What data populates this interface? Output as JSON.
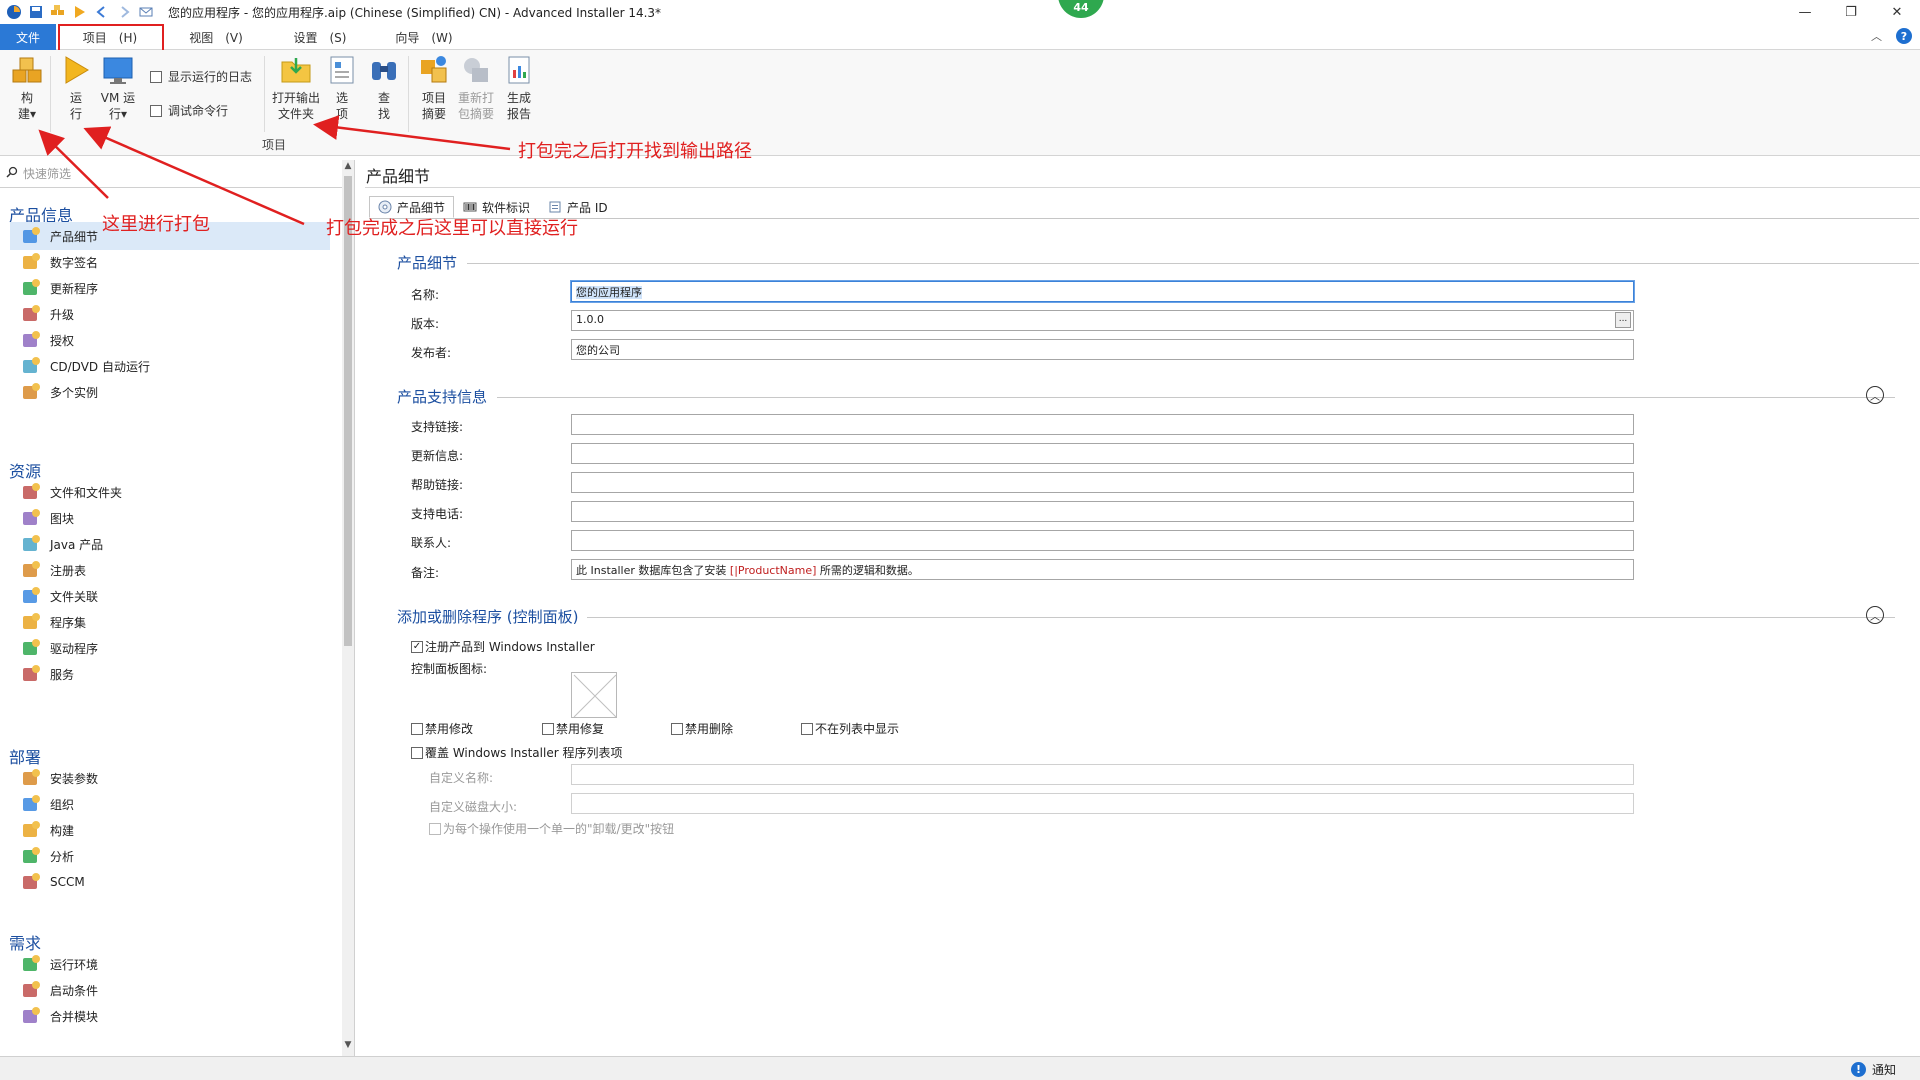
{
  "titlebar": {
    "title": "您的应用程序 - 您的应用程序.aip (Chinese (Simplified) CN) - Advanced Installer 14.3*",
    "badge": "44",
    "controls": {
      "minimize": "—",
      "restore": "❐",
      "close": "✕"
    }
  },
  "menu": {
    "tabs": [
      "文件",
      "项目　(H)",
      "视图　(V)",
      "设置　(S)",
      "向导　(W)"
    ],
    "help": "?"
  },
  "ribbon": {
    "build": "构\n建▾",
    "run": "运\n行",
    "vm_run": "VM 运\n行▾",
    "show_log": "显示运行的日志",
    "debug_cmd": "调试命令行",
    "open_output": "打开输出\n文件夹",
    "options": "选\n项",
    "find": "查\n找",
    "project_summary": "项目\n摘要",
    "repack_summary": "重新打\n包摘要",
    "gen_report": "生成\n报告",
    "group_label": "项目"
  },
  "sidebar": {
    "search_placeholder": "快速筛选",
    "sections": [
      {
        "title": "产品信息",
        "items": [
          "产品细节",
          "数字签名",
          "更新程序",
          "升级",
          "授权",
          "CD/DVD 自动运行",
          "多个实例"
        ]
      },
      {
        "title": "资源",
        "items": [
          "文件和文件夹",
          "图块",
          "Java 产品",
          "注册表",
          "文件关联",
          "程序集",
          "驱动程序",
          "服务"
        ]
      },
      {
        "title": "部署",
        "items": [
          "安装参数",
          "组织",
          "构建",
          "分析",
          "SCCM"
        ]
      },
      {
        "title": "需求",
        "items": [
          "运行环境",
          "启动条件",
          "合并模块"
        ]
      }
    ],
    "selected": "产品细节"
  },
  "main": {
    "header": "产品细节",
    "tabs": [
      "产品细节",
      "软件标识",
      "产品 ID"
    ],
    "product_details": {
      "title": "产品细节",
      "name_label": "名称:",
      "name_value": "您的应用程序",
      "version_label": "版本:",
      "version_value": "1.0.0",
      "publisher_label": "发布者:",
      "publisher_value": "您的公司",
      "ellipsis": "..."
    },
    "support": {
      "title": "产品支持信息",
      "labels": [
        "支持链接:",
        "更新信息:",
        "帮助链接:",
        "支持电话:",
        "联系人:",
        "备注:"
      ],
      "comment_prefix": "此 Installer 数据库包含了安装 ",
      "comment_token": "[|ProductName]",
      "comment_suffix": " 所需的逻辑和数据。"
    },
    "arp": {
      "title": "添加或删除程序 (控制面板)",
      "register": "注册产品到 Windows Installer",
      "icon_label": "控制面板图标:",
      "disable_modify": "禁用修改",
      "disable_repair": "禁用修复",
      "disable_remove": "禁用删除",
      "hide_in_list": "不在列表中显示",
      "override_entry": "覆盖 Windows Installer 程序列表项",
      "custom_name": "自定义名称:",
      "custom_size": "自定义磁盘大小:",
      "single_button": "为每个操作使用一个单一的\"卸载/更改\"按钮"
    }
  },
  "statusbar": {
    "notify": "通知"
  },
  "annotations": {
    "build_here": "这里进行打包",
    "run_here": "打包完成之后这里可以直接运行",
    "open_output": "打包完之后打开找到输出路径"
  },
  "colors": {
    "accent": "#2b79d6",
    "annotation": "#e02020",
    "section": "#1c4fa0"
  }
}
